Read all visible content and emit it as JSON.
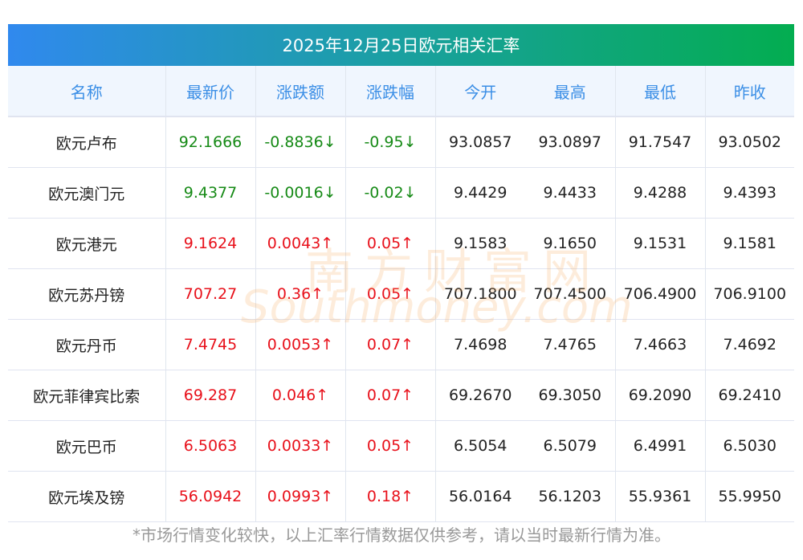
{
  "title": "2025年12月25日欧元相关汇率",
  "headers": [
    "名称",
    "最新价",
    "涨跌额",
    "涨跌幅",
    "今开",
    "最高",
    "最低",
    "昨收"
  ],
  "rows": [
    {
      "dir": "down",
      "cells": [
        "欧元卢布",
        "92.1666",
        "-0.8836↓",
        "-0.95↓",
        "93.0857",
        "93.0897",
        "91.7547",
        "93.0502"
      ]
    },
    {
      "dir": "down",
      "cells": [
        "欧元澳门元",
        "9.4377",
        "-0.0016↓",
        "-0.02↓",
        "9.4429",
        "9.4433",
        "9.4288",
        "9.4393"
      ]
    },
    {
      "dir": "up",
      "cells": [
        "欧元港元",
        "9.1624",
        "0.0043↑",
        "0.05↑",
        "9.1583",
        "9.1650",
        "9.1531",
        "9.1581"
      ]
    },
    {
      "dir": "up",
      "cells": [
        "欧元苏丹镑",
        "707.27",
        "0.36↑",
        "0.05↑",
        "707.1800",
        "707.4500",
        "706.4900",
        "706.9100"
      ]
    },
    {
      "dir": "up",
      "cells": [
        "欧元丹币",
        "7.4745",
        "0.0053↑",
        "0.07↑",
        "7.4698",
        "7.4765",
        "7.4663",
        "7.4692"
      ]
    },
    {
      "dir": "up",
      "cells": [
        "欧元菲律宾比索",
        "69.287",
        "0.046↑",
        "0.07↑",
        "69.2670",
        "69.3050",
        "69.2090",
        "69.2410"
      ]
    },
    {
      "dir": "up",
      "cells": [
        "欧元巴币",
        "6.5063",
        "0.0033↑",
        "0.05↑",
        "6.5054",
        "6.5079",
        "6.4991",
        "6.5030"
      ]
    },
    {
      "dir": "up",
      "cells": [
        "欧元埃及镑",
        "56.0942",
        "0.0993↑",
        "0.18↑",
        "56.0164",
        "56.1203",
        "55.9361",
        "55.9950"
      ]
    }
  ],
  "watermark": {
    "cn": "南方财富网",
    "en": "Southmoney.com"
  },
  "note": "*市场行情变化较快，以上汇率行情数据仅供参考，请以当时最新行情为准。",
  "colors": {
    "up": "#e8111b",
    "down": "#168a16",
    "header_text": "#3a8ee6"
  }
}
